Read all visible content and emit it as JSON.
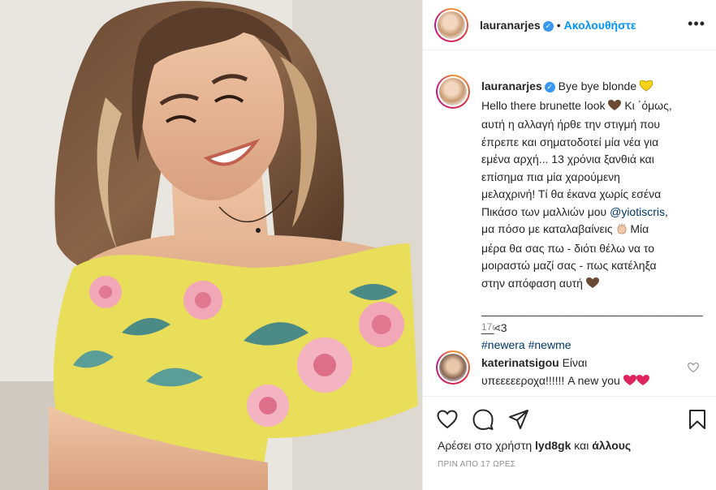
{
  "post": {
    "author": {
      "username": "lauranarjes",
      "verified_icon": "verified-badge-icon",
      "follow_label": "Ακολουθήστε",
      "separator": "•"
    },
    "caption": {
      "username": "lauranarjes",
      "lines": [
        "Bye bye blonde",
        "Hello there brunette look",
        "Κι ΄όμως,",
        "αυτή η αλλαγή ήρθε την στιγμή που",
        "έπρεπε και σηματοδοτεί μία νέα για",
        "εμένα αρχή... 13 χρόνια ξανθιά και",
        "επίσημα πια μία χαρούμενη",
        "μελαχρινή! Τί θα έκανα χωρίς εσένα",
        "Πικάσο των μαλλιών μου",
        "@yiotiscris",
        ",",
        "μα πόσο με καταλαβαίνεις",
        "Μία",
        "μέρα θα σας πω - διότι θέλω να το",
        "μοιραστώ μαζί σας - πως κατέληξα",
        "στην απόφαση αυτή",
        "___________________________________",
        "__<3"
      ],
      "hashtags": [
        "#newera",
        "#newme"
      ],
      "time_ago": "17ω"
    },
    "comment": {
      "username": "katerinatsigou",
      "text_1": "Είναι",
      "text_2": "υπεεεεεροχα!!!!!! A new you"
    },
    "likes": {
      "prefix": "Αρέσει στο χρήστη",
      "user": "lyd8gk",
      "middle": "και",
      "others": "άλλους"
    },
    "timestamp": "ΠΡΙΝ ΑΠΟ 17 ΩΡΕΣ",
    "colors": {
      "accent": "#0095f6",
      "verified": "#3897f0",
      "mention": "#00376b",
      "muted": "#8e8e8e",
      "heart_red": "#e0245e",
      "brown_heart": "#6b4a34",
      "yellow_heart": "#f7d21b",
      "dress_yellow": "#e9de5a"
    }
  }
}
